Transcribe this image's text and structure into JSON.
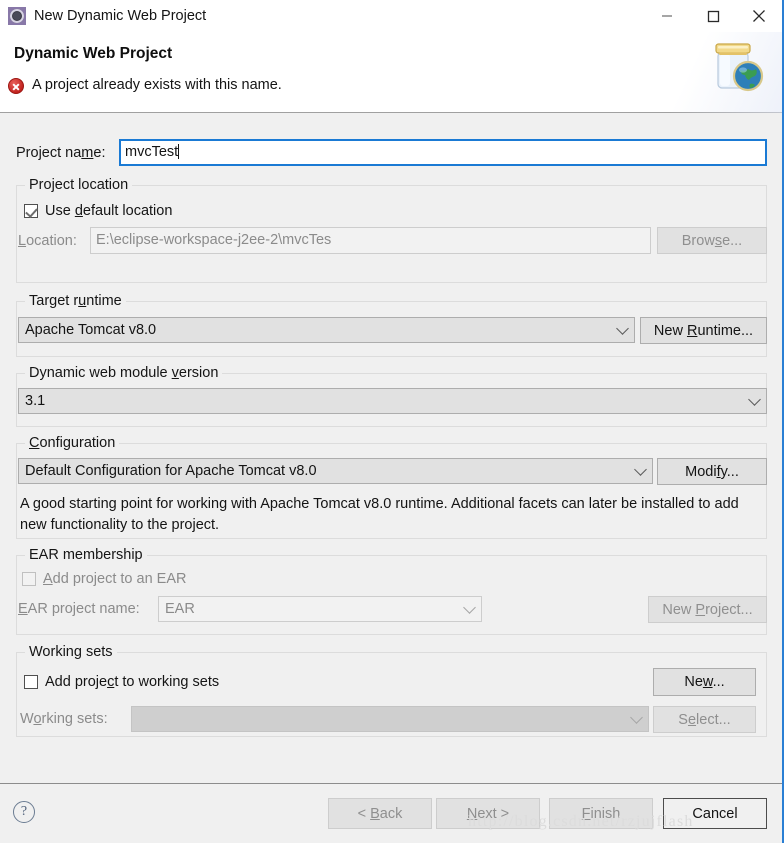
{
  "window": {
    "title": "New Dynamic Web Project",
    "icon": "eclipse-wizard-icon",
    "controls": {
      "minimize": "minimize-icon",
      "maximize": "maximize-icon",
      "close": "close-icon"
    }
  },
  "header": {
    "title": "Dynamic Web Project",
    "message": "A project already exists with this name.",
    "status_icon": "error-icon",
    "banner_icon": "java-web-jar-globe-icon"
  },
  "form": {
    "project_name": {
      "label": "Project name:",
      "label_mnemonic": "m",
      "value": "mvcTest",
      "focused": true
    },
    "project_location": {
      "group_label": "Project location",
      "use_default": {
        "label": "Use default location",
        "mnemonic": "d",
        "checked": true,
        "enabled": true
      },
      "location": {
        "label": "Location:",
        "label_mnemonic": "L",
        "value": "E:\\eclipse-workspace-j2ee-2\\mvcTes",
        "enabled": false
      },
      "browse_button": {
        "label": "Browse...",
        "mnemonic": "s",
        "enabled": false
      }
    },
    "target_runtime": {
      "group_label": "Target runtime",
      "group_mnemonic": "u",
      "value": "Apache Tomcat v8.0",
      "new_runtime_button": {
        "label": "New Runtime...",
        "mnemonic": "R",
        "enabled": true
      }
    },
    "dynamic_web_module_version": {
      "group_label": "Dynamic web module version",
      "group_mnemonic": "v",
      "value": "3.1"
    },
    "configuration": {
      "group_label": "Configuration",
      "group_mnemonic": "C",
      "value": "Default Configuration for Apache Tomcat v8.0",
      "modify_button": {
        "label": "Modify...",
        "mnemonic": "f",
        "enabled": true
      },
      "description": "A good starting point for working with Apache Tomcat v8.0 runtime. Additional facets can later be installed to add new functionality to the project."
    },
    "ear_membership": {
      "group_label": "EAR membership",
      "add_to_ear": {
        "label": "Add project to an EAR",
        "mnemonic": "A",
        "checked": false,
        "enabled": false
      },
      "ear_project_name": {
        "label": "EAR project name:",
        "label_mnemonic": "E",
        "value": "EAR",
        "enabled": false
      },
      "new_project_button": {
        "label": "New Project...",
        "mnemonic": "P",
        "enabled": false
      }
    },
    "working_sets": {
      "group_label": "Working sets",
      "add_to_working_sets": {
        "label": "Add project to working sets",
        "mnemonic": "c",
        "checked": false,
        "enabled": true
      },
      "working_sets_field": {
        "label": "Working sets:",
        "label_mnemonic": "o",
        "value": "",
        "enabled": false
      },
      "new_button": {
        "label": "New...",
        "mnemonic": "w",
        "enabled": true
      },
      "select_button": {
        "label": "Select...",
        "mnemonic": "e",
        "enabled": false
      }
    }
  },
  "footer": {
    "help_icon": "help-icon",
    "buttons": {
      "back": {
        "label": "< Back",
        "mnemonic": "B",
        "enabled": false
      },
      "next": {
        "label": "Next >",
        "mnemonic": "N",
        "enabled": false
      },
      "finish": {
        "label": "Finish",
        "mnemonic": "F",
        "enabled": false
      },
      "cancel": {
        "label": "Cancel",
        "enabled": true,
        "default": true
      }
    }
  },
  "watermark": "http://blog.csdn.net/rzjujflash",
  "colors": {
    "dialog_bg": "#f0f0f0",
    "header_bg": "#ffffff",
    "focus_border": "#1a7ad4",
    "error_red": "#c0201c",
    "disabled_text": "#8b8b8b"
  }
}
